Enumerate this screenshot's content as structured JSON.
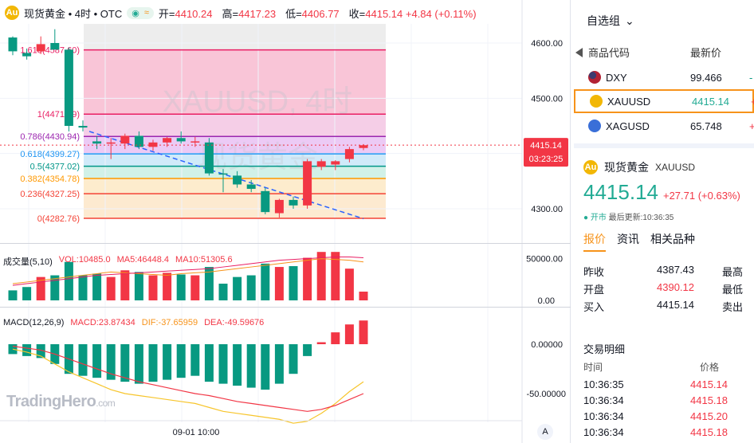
{
  "header": {
    "symbol_icon": "gold-coin-icon",
    "title": "现货黄金 • 4时 • OTC",
    "pill_up": "◉",
    "pill_wave": "≈",
    "open_label": "开=",
    "open_value": "4410.24",
    "high_label": "高=",
    "high_value": "4417.23",
    "low_label": "低=",
    "low_value": "4406.77",
    "close_label": "收=",
    "close_value": "4415.14 +4.84 (+0.11%)"
  },
  "watermark": {
    "line1": "XAUUSD, 4时",
    "line2": "现货黄金"
  },
  "fib_levels": [
    {
      "label": "1.618(4587.60)",
      "value": 4587.6,
      "color": "#e91e63"
    },
    {
      "label": "1(4471.29)",
      "value": 4471.29,
      "color": "#e91e63"
    },
    {
      "label": "0.786(4430.94)",
      "value": 4430.94,
      "color": "#9c27b0"
    },
    {
      "label": "0.618(4399.27)",
      "value": 4399.27,
      "color": "#2196f3"
    },
    {
      "label": "0.5(4377.02)",
      "value": 4377.02,
      "color": "#009688"
    },
    {
      "label": "0.382(4354.78)",
      "value": 4354.78,
      "color": "#ff9800"
    },
    {
      "label": "0.236(4327.25)",
      "value": 4327.25,
      "color": "#f44336"
    },
    {
      "label": "0(4282.76)",
      "value": 4282.76,
      "color": "#f44336"
    }
  ],
  "price_axis": {
    "ticks": [
      "4600.00",
      "4500.00",
      "4300.00"
    ],
    "current": "4415.14",
    "countdown": "03:23:25"
  },
  "volume": {
    "legend_title": "成交量(5,10)",
    "vol_label": "VOL:10485.0",
    "ma5_label": "MA5:46448.4",
    "ma10_label": "MA10:51305.6",
    "ticks": [
      "50000.00",
      "0.00"
    ]
  },
  "macd": {
    "legend_title": "MACD(12,26,9)",
    "macd_label": "MACD:23.87434",
    "dif_label": "DIF:-37.65959",
    "dea_label": "DEA:-49.59676",
    "ticks": [
      "0.00000",
      "-50.00000"
    ]
  },
  "time_axis": {
    "label": "09-01 10:00",
    "auto_button": "A"
  },
  "logo": {
    "name": "TradingHero",
    "suffix": ".com"
  },
  "chart_data": {
    "type": "candlestick",
    "ylim": [
      4270,
      4620
    ],
    "candles": [
      [
        4610,
        4612,
        4578,
        4585,
        1
      ],
      [
        4582,
        4590,
        4570,
        4576,
        0
      ],
      [
        4585,
        4612,
        4580,
        4598,
        1
      ],
      [
        4600,
        4625,
        4590,
        4588,
        0
      ],
      [
        4588,
        4592,
        4440,
        4450,
        0
      ],
      [
        4450,
        4460,
        4440,
        4447,
        0
      ],
      [
        4422,
        4432,
        4408,
        4418,
        1
      ],
      [
        4418,
        4428,
        4390,
        4420,
        1
      ],
      [
        4418,
        4436,
        4408,
        4432,
        1
      ],
      [
        4432,
        4440,
        4408,
        4412,
        0
      ],
      [
        4412,
        4425,
        4405,
        4420,
        1
      ],
      [
        4420,
        4430,
        4412,
        4428,
        1
      ],
      [
        4428,
        4440,
        4418,
        4422,
        0
      ],
      [
        4422,
        4430,
        4412,
        4422,
        0
      ],
      [
        4420,
        4428,
        4360,
        4364,
        0
      ],
      [
        4364,
        4372,
        4330,
        4362,
        1
      ],
      [
        4360,
        4368,
        4338,
        4344,
        0
      ],
      [
        4344,
        4352,
        4330,
        4336,
        0
      ],
      [
        4332,
        4338,
        4290,
        4294,
        0
      ],
      [
        4292,
        4318,
        4284,
        4316,
        1
      ],
      [
        4316,
        4322,
        4300,
        4306,
        0
      ],
      [
        4306,
        4390,
        4300,
        4386,
        1
      ],
      [
        4376,
        4390,
        4370,
        4386,
        1
      ],
      [
        4380,
        4388,
        4370,
        4386,
        1
      ],
      [
        4390,
        4412,
        4384,
        4408,
        1
      ],
      [
        4410,
        4417,
        4406,
        4415,
        1
      ]
    ],
    "volumes": [
      [
        12000,
        1
      ],
      [
        16000,
        0
      ],
      [
        28000,
        1
      ],
      [
        30000,
        0
      ],
      [
        46000,
        0
      ],
      [
        30000,
        1
      ],
      [
        32000,
        0
      ],
      [
        28000,
        1
      ],
      [
        36000,
        1
      ],
      [
        34000,
        0
      ],
      [
        30000,
        1
      ],
      [
        33000,
        1
      ],
      [
        31000,
        0
      ],
      [
        30000,
        0
      ],
      [
        40000,
        0
      ],
      [
        20000,
        1
      ],
      [
        28000,
        0
      ],
      [
        30000,
        0
      ],
      [
        44000,
        0
      ],
      [
        40000,
        1
      ],
      [
        41000,
        0
      ],
      [
        51000,
        1
      ],
      [
        58000,
        0
      ],
      [
        58000,
        1
      ],
      [
        38000,
        1
      ],
      [
        10485,
        1
      ]
    ],
    "macd_hist": [
      -10,
      -12,
      -14,
      -20,
      -30,
      -32,
      -34,
      -36,
      -38,
      -40,
      -38,
      -36,
      -34,
      -32,
      -38,
      -40,
      -42,
      -44,
      -46,
      -40,
      -30,
      -12,
      2,
      12,
      20,
      24
    ],
    "dif": [
      -5,
      -8,
      -12,
      -20,
      -28,
      -34,
      -40,
      -46,
      -50,
      -52,
      -54,
      -56,
      -58,
      -60,
      -64,
      -68,
      -70,
      -72,
      -74,
      -76,
      -80,
      -78,
      -70,
      -60,
      -48,
      -38
    ],
    "dea": [
      -2,
      -4,
      -6,
      -10,
      -15,
      -20,
      -25,
      -30,
      -34,
      -38,
      -41,
      -44,
      -47,
      -50,
      -52,
      -55,
      -58,
      -60,
      -62,
      -64,
      -66,
      -68,
      -66,
      -62,
      -56,
      -50
    ],
    "ma_vol_5": [
      20,
      22,
      24,
      26,
      28,
      30,
      32,
      34,
      33,
      32,
      31,
      30,
      32,
      33,
      34,
      36,
      38,
      40,
      42,
      44,
      46,
      48,
      50,
      49,
      48,
      46
    ],
    "ma_vol_10": [
      18,
      20,
      22,
      24,
      26,
      28,
      30,
      31,
      32,
      33,
      34,
      35,
      36,
      37,
      38,
      40,
      42,
      44,
      46,
      48,
      49,
      50,
      51,
      52,
      52,
      51
    ],
    "up_color": "#f23645",
    "down_color": "#089981"
  },
  "watchlist": {
    "title": "自选组",
    "chevron_icon": "chevron-down-icon",
    "col_code": "商品代码",
    "col_price": "最新价",
    "items": [
      {
        "code": "DXY",
        "price": "99.466",
        "change": "-",
        "flag": "us-flag-icon"
      },
      {
        "code": "XAUUSD",
        "price": "4415.14",
        "change": "+",
        "flag": "gold-coin-icon"
      },
      {
        "code": "XAGUSD",
        "price": "65.748",
        "change": "+",
        "flag": "silver-coin-icon"
      }
    ]
  },
  "detail": {
    "name": "现货黄金",
    "code": "XAUUSD",
    "price": "4415.14",
    "change": "+27.71 (+0.63%)",
    "status_open": "● 开市",
    "status_time": "最后更新:10:36:35",
    "tabs": [
      "报价",
      "资讯",
      "相关品种"
    ],
    "quotes": [
      {
        "k": "昨收",
        "v": "4387.43",
        "k2": "最高",
        "red": false
      },
      {
        "k": "开盘",
        "v": "4390.12",
        "k2": "最低",
        "red": true
      },
      {
        "k": "买入",
        "v": "4415.14",
        "k2": "卖出",
        "red": false
      }
    ],
    "trades_title": "交易明细",
    "trades_col_time": "时间",
    "trades_col_price": "价格",
    "trades": [
      {
        "t": "10:36:35",
        "p": "4415.14"
      },
      {
        "t": "10:36:34",
        "p": "4415.18"
      },
      {
        "t": "10:36:34",
        "p": "4415.20"
      },
      {
        "t": "10:36:34",
        "p": "4415.18"
      }
    ]
  }
}
